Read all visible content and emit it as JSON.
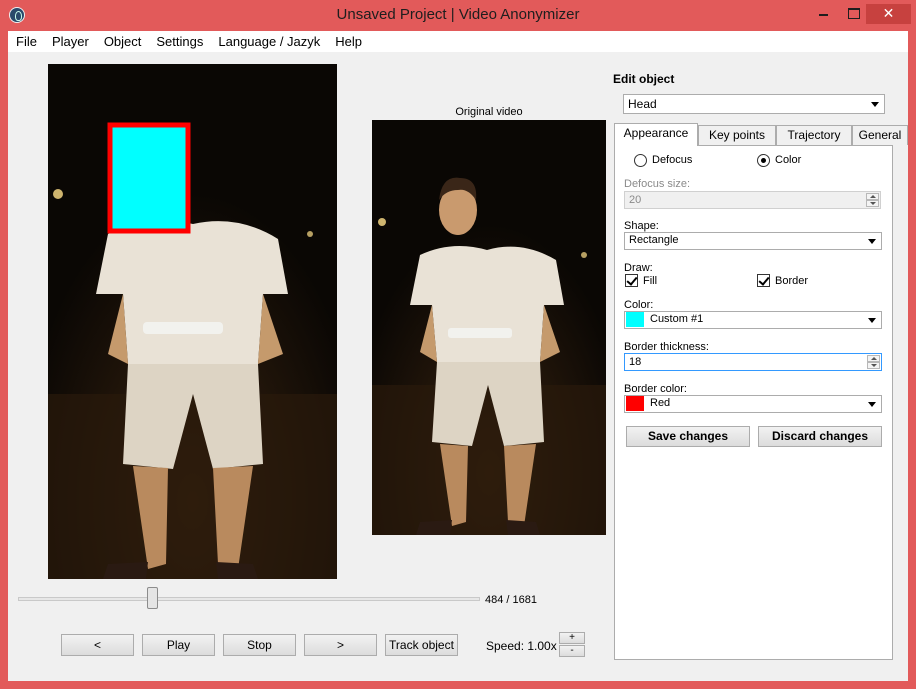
{
  "window": {
    "title": "Unsaved Project | Video Anonymizer",
    "close_glyph": "✕"
  },
  "menu": [
    "File",
    "Player",
    "Object",
    "Settings",
    "Language / Jazyk",
    "Help"
  ],
  "preview": {
    "original_label": "Original video",
    "mask_fill_color": "#00ffff",
    "mask_border_color": "#ff0000"
  },
  "player": {
    "frame_counter": "484 / 1681",
    "position_fraction": 0.288,
    "prev_label": "<",
    "play_label": "Play",
    "stop_label": "Stop",
    "next_label": ">",
    "track_label": "Track object",
    "speed_label": "Speed: 1.00x",
    "speed_up": "+",
    "speed_down": "-"
  },
  "edit": {
    "title": "Edit object",
    "object_selected": "Head",
    "tabs": [
      "Appearance",
      "Key points",
      "Trajectory",
      "General"
    ],
    "active_tab": "Appearance",
    "mode_defocus": "Defocus",
    "mode_color": "Color",
    "mode_selected": "Color",
    "defocus_size_label": "Defocus size:",
    "defocus_size_value": "20",
    "shape_label": "Shape:",
    "shape_value": "Rectangle",
    "draw_label": "Draw:",
    "draw_fill": "Fill",
    "draw_border": "Border",
    "color_label": "Color:",
    "color_value": "Custom #1",
    "color_swatch": "#00ffff",
    "border_thickness_label": "Border thickness:",
    "border_thickness_value": "18",
    "border_color_label": "Border color:",
    "border_color_value": "Red",
    "border_color_swatch": "#ff0000",
    "save_label": "Save changes",
    "discard_label": "Discard changes"
  }
}
